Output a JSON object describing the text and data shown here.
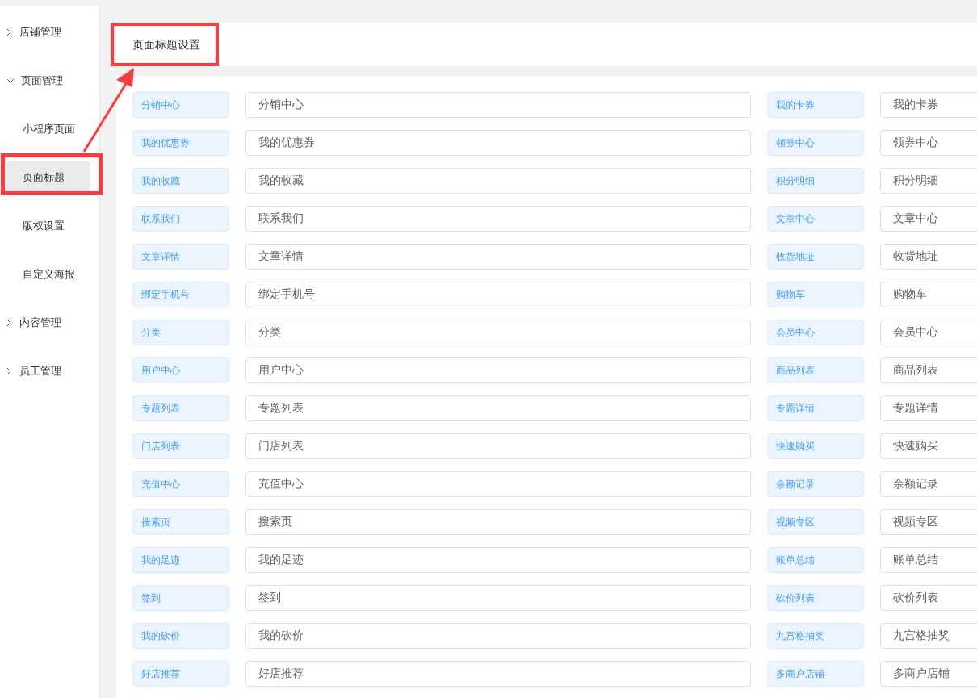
{
  "sidebar": {
    "items": [
      {
        "label": "店铺管理",
        "expanded": false
      },
      {
        "label": "页面管理",
        "expanded": true,
        "children": [
          {
            "label": "小程序页面",
            "selected": false
          },
          {
            "label": "页面标题",
            "selected": true
          },
          {
            "label": "版权设置",
            "selected": false
          },
          {
            "label": "自定义海报",
            "selected": false
          }
        ]
      },
      {
        "label": "内容管理",
        "expanded": false
      },
      {
        "label": "员工管理",
        "expanded": false
      }
    ]
  },
  "panel_title": "页面标题设置",
  "rows": [
    {
      "left": {
        "label": "分销中心",
        "value": "分销中心"
      },
      "right": {
        "label": "我的卡券",
        "value": "我的卡券"
      }
    },
    {
      "left": {
        "label": "我的优惠券",
        "value": "我的优惠券"
      },
      "right": {
        "label": "领券中心",
        "value": "领券中心"
      }
    },
    {
      "left": {
        "label": "我的收藏",
        "value": "我的收藏"
      },
      "right": {
        "label": "积分明细",
        "value": "积分明细"
      }
    },
    {
      "left": {
        "label": "联系我们",
        "value": "联系我们"
      },
      "right": {
        "label": "文章中心",
        "value": "文章中心"
      }
    },
    {
      "left": {
        "label": "文章详情",
        "value": "文章详情"
      },
      "right": {
        "label": "收货地址",
        "value": "收货地址"
      }
    },
    {
      "left": {
        "label": "绑定手机号",
        "value": "绑定手机号"
      },
      "right": {
        "label": "购物车",
        "value": "购物车"
      }
    },
    {
      "left": {
        "label": "分类",
        "value": "分类"
      },
      "right": {
        "label": "会员中心",
        "value": "会员中心"
      }
    },
    {
      "left": {
        "label": "用户中心",
        "value": "用户中心"
      },
      "right": {
        "label": "商品列表",
        "value": "商品列表"
      }
    },
    {
      "left": {
        "label": "专题列表",
        "value": "专题列表"
      },
      "right": {
        "label": "专题详情",
        "value": "专题详情"
      }
    },
    {
      "left": {
        "label": "门店列表",
        "value": "门店列表"
      },
      "right": {
        "label": "快速购买",
        "value": "快速购买"
      }
    },
    {
      "left": {
        "label": "充值中心",
        "value": "充值中心"
      },
      "right": {
        "label": "余额记录",
        "value": "余额记录"
      }
    },
    {
      "left": {
        "label": "搜索页",
        "value": "搜索页"
      },
      "right": {
        "label": "视频专区",
        "value": "视频专区"
      }
    },
    {
      "left": {
        "label": "我的足迹",
        "value": "我的足迹"
      },
      "right": {
        "label": "账单总结",
        "value": "账单总结"
      }
    },
    {
      "left": {
        "label": "签到",
        "value": "签到"
      },
      "right": {
        "label": "砍价列表",
        "value": "砍价列表"
      }
    },
    {
      "left": {
        "label": "我的砍价",
        "value": "我的砍价"
      },
      "right": {
        "label": "九宫格抽奖",
        "value": "九宫格抽奖"
      }
    },
    {
      "left": {
        "label": "好店推荐",
        "value": "好店推荐"
      },
      "right": {
        "label": "多商户店铺",
        "value": "多商户店铺"
      }
    }
  ]
}
